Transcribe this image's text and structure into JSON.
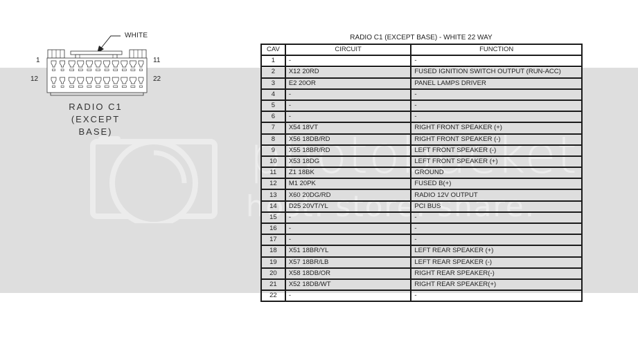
{
  "watermark": {
    "brand": "photobucket",
    "tagline": "host. store. share."
  },
  "connector": {
    "color_label": "WHITE",
    "pin_labels": {
      "top_left": "1",
      "top_right": "11",
      "bottom_left": "12",
      "bottom_right": "22"
    },
    "caption_lines": [
      "RADIO C1",
      "(EXCEPT",
      "BASE)"
    ]
  },
  "table": {
    "title": "RADIO C1 (EXCEPT BASE) - WHITE 22 WAY",
    "headers": [
      "CAV",
      "CIRCUIT",
      "FUNCTION"
    ],
    "rows": [
      {
        "cav": "1",
        "circuit": "-",
        "function": "-"
      },
      {
        "cav": "2",
        "circuit": "X12 20RD",
        "function": "FUSED IGNITION SWITCH OUTPUT (RUN-ACC)"
      },
      {
        "cav": "3",
        "circuit": "E2 20OR",
        "function": "PANEL LAMPS DRIVER"
      },
      {
        "cav": "4",
        "circuit": "-",
        "function": "-"
      },
      {
        "cav": "5",
        "circuit": "-",
        "function": "-"
      },
      {
        "cav": "6",
        "circuit": "-",
        "function": "-"
      },
      {
        "cav": "7",
        "circuit": "X54 18VT",
        "function": "RIGHT FRONT SPEAKER (+)"
      },
      {
        "cav": "8",
        "circuit": "X56 18DB/RD",
        "function": "RIGHT FRONT SPEAKER (-)"
      },
      {
        "cav": "9",
        "circuit": "X55 18BR/RD",
        "function": "LEFT FRONT SPEAKER (-)"
      },
      {
        "cav": "10",
        "circuit": "X53 18DG",
        "function": "LEFT FRONT SPEAKER (+)"
      },
      {
        "cav": "11",
        "circuit": "Z1 18BK",
        "function": "GROUND"
      },
      {
        "cav": "12",
        "circuit": "M1 20PK",
        "function": "FUSED B(+)"
      },
      {
        "cav": "13",
        "circuit": "X60 20DG/RD",
        "function": "RADIO 12V OUTPUT"
      },
      {
        "cav": "14",
        "circuit": "D25 20VT/YL",
        "function": "PCI BUS"
      },
      {
        "cav": "15",
        "circuit": "-",
        "function": "-"
      },
      {
        "cav": "16",
        "circuit": "-",
        "function": "-"
      },
      {
        "cav": "17",
        "circuit": "-",
        "function": "-"
      },
      {
        "cav": "18",
        "circuit": "X51 18BR/YL",
        "function": "LEFT REAR SPEAKER (+)"
      },
      {
        "cav": "19",
        "circuit": "X57 18BR/LB",
        "function": "LEFT REAR SPEAKER (-)"
      },
      {
        "cav": "20",
        "circuit": "X58 18DB/OR",
        "function": "RIGHT REAR SPEAKER(-)"
      },
      {
        "cav": "21",
        "circuit": "X52 18DB/WT",
        "function": "RIGHT REAR SPEAKER(+)"
      },
      {
        "cav": "22",
        "circuit": "-",
        "function": "-"
      }
    ]
  }
}
